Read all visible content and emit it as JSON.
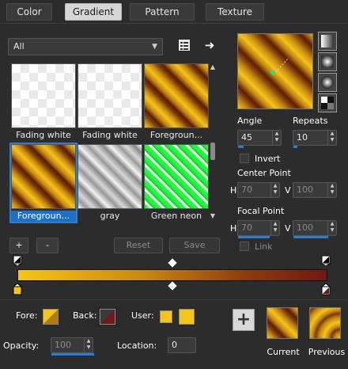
{
  "tabs": [
    {
      "label": "Color"
    },
    {
      "label": "Gradient"
    },
    {
      "label": "Pattern"
    },
    {
      "label": "Texture"
    }
  ],
  "category_dropdown": {
    "value": "All"
  },
  "gradients": [
    {
      "label": "Fading white",
      "style": "fadewhite"
    },
    {
      "label": "Fading white",
      "style": "fadewhite"
    },
    {
      "label": "Foregroun...",
      "style": "stripes"
    },
    {
      "label": "Foregroun...",
      "style": "stripes",
      "selected": true
    },
    {
      "label": "gray",
      "style": "graygrad"
    },
    {
      "label": "Green neon",
      "style": "greenneon"
    }
  ],
  "buttons": {
    "add": "+",
    "remove": "-",
    "reset": "Reset",
    "save": "Save"
  },
  "angle": {
    "label": "Angle",
    "value": "45",
    "fill": 0.13
  },
  "repeats": {
    "label": "Repeats",
    "value": "10",
    "fill": 0.1
  },
  "invert_label": "Invert",
  "center_point": {
    "label": "Center Point",
    "h_label": "H",
    "h_value": "70",
    "v_label": "V",
    "v_value": "100"
  },
  "focal_point": {
    "label": "Focal Point",
    "h_label": "H",
    "h_value": "70",
    "v_label": "V",
    "v_value": "100"
  },
  "link_label": "Link",
  "bottom": {
    "fore_label": "Fore:",
    "back_label": "Back:",
    "user_label": "User:",
    "opacity_label": "Opacity:",
    "opacity_value": "100",
    "location_label": "Location:",
    "location_value": "0",
    "current_label": "Current",
    "previous_label": "Previous"
  },
  "colors": {
    "accent": "#2a7fd4",
    "fore": "#f5c518",
    "back": "#6e1a14",
    "user1": "#f5c518",
    "user2": "#f5c518"
  }
}
